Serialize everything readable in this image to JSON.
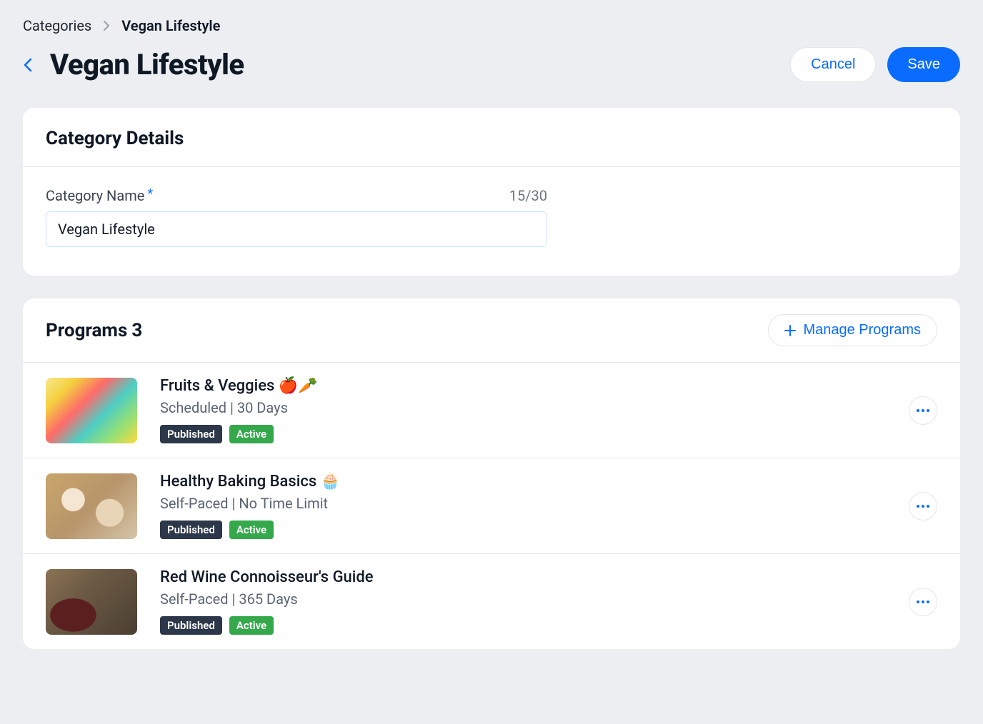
{
  "breadcrumb": {
    "parent": "Categories",
    "current": "Vegan Lifestyle"
  },
  "header": {
    "title": "Vegan Lifestyle",
    "cancel_label": "Cancel",
    "save_label": "Save"
  },
  "details": {
    "section_title": "Category Details",
    "name_label": "Category Name",
    "name_value": "Vegan Lifestyle",
    "char_count": "15/30"
  },
  "programs": {
    "section_label": "Programs",
    "count": "3",
    "manage_label": "Manage Programs",
    "items": [
      {
        "title": "Fruits & Veggies 🍎🥕",
        "meta": "Scheduled | 30 Days",
        "status_label": "Published",
        "active_label": "Active"
      },
      {
        "title": "Healthy Baking Basics 🧁",
        "meta": "Self-Paced | No Time Limit",
        "status_label": "Published",
        "active_label": "Active"
      },
      {
        "title": "Red Wine Connoisseur's Guide",
        "meta": "Self-Paced | 365 Days",
        "status_label": "Published",
        "active_label": "Active"
      }
    ]
  }
}
